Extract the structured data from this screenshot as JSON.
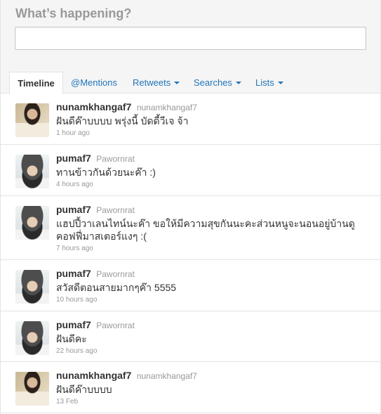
{
  "compose": {
    "title": "What’s happening?",
    "input_value": ""
  },
  "tabs": [
    {
      "label": "Timeline",
      "active": true,
      "has_dropdown": false
    },
    {
      "label": "@Mentions",
      "active": false,
      "has_dropdown": false
    },
    {
      "label": "Retweets",
      "active": false,
      "has_dropdown": true
    },
    {
      "label": "Searches",
      "active": false,
      "has_dropdown": true
    },
    {
      "label": "Lists",
      "active": false,
      "has_dropdown": true
    }
  ],
  "tweets": [
    {
      "screen_name": "nunamkhangaf7",
      "full_name": "nunamkhangaf7",
      "text": "ฝันดีค๊าบบบบ พรุ่งนี้ บัดดี้วีเจ จ้า",
      "time": "1 hour ago",
      "avatar": "avatar-nunamkhangaf7"
    },
    {
      "screen_name": "pumaf7",
      "full_name": "Pawornrat",
      "text": "ทานข้าวกันด้วยนะค๊า :)",
      "time": "4 hours ago",
      "avatar": "avatar-pumaf7"
    },
    {
      "screen_name": "pumaf7",
      "full_name": "Pawornrat",
      "text": "แฮปปี้วาเลนไทน์นะค๊า ขอให้มีความสุขกันนะคะส่วนหนูจะนอนอยู่บ้านดูคอฟฟี่มาสเตอร์แงๆ :(",
      "time": "7 hours ago",
      "avatar": "avatar-pumaf7"
    },
    {
      "screen_name": "pumaf7",
      "full_name": "Pawornrat",
      "text": "สวัสดีตอนสายมากๆค๊า 5555",
      "time": "10 hours ago",
      "avatar": "avatar-pumaf7"
    },
    {
      "screen_name": "pumaf7",
      "full_name": "Pawornrat",
      "text": "ฝันดีคะ",
      "time": "22 hours ago",
      "avatar": "avatar-pumaf7"
    },
    {
      "screen_name": "nunamkhangaf7",
      "full_name": "nunamkhangaf7",
      "text": "ฝันดีค๊าบบบบ",
      "time": "13 Feb",
      "avatar": "avatar-nunamkhangaf7"
    }
  ],
  "colors": {
    "link": "#2276bb",
    "text": "#333333",
    "muted": "#999999",
    "panel_bg": "#f5f5f5",
    "border": "#e3e3e3"
  }
}
